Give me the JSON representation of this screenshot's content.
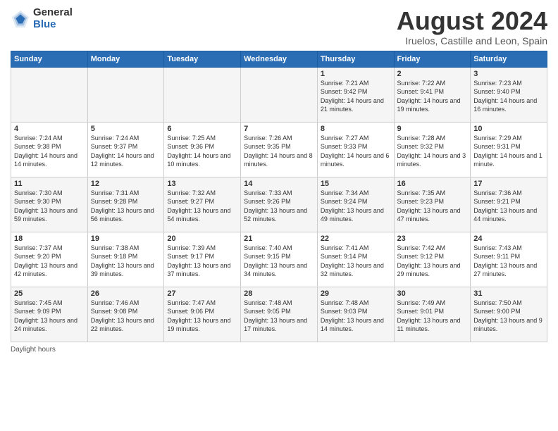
{
  "header": {
    "logo_general": "General",
    "logo_blue": "Blue",
    "title": "August 2024",
    "subtitle": "Iruelos, Castille and Leon, Spain"
  },
  "days_of_week": [
    "Sunday",
    "Monday",
    "Tuesday",
    "Wednesday",
    "Thursday",
    "Friday",
    "Saturday"
  ],
  "weeks": [
    [
      {
        "num": "",
        "info": ""
      },
      {
        "num": "",
        "info": ""
      },
      {
        "num": "",
        "info": ""
      },
      {
        "num": "",
        "info": ""
      },
      {
        "num": "1",
        "info": "Sunrise: 7:21 AM\nSunset: 9:42 PM\nDaylight: 14 hours and 21 minutes."
      },
      {
        "num": "2",
        "info": "Sunrise: 7:22 AM\nSunset: 9:41 PM\nDaylight: 14 hours and 19 minutes."
      },
      {
        "num": "3",
        "info": "Sunrise: 7:23 AM\nSunset: 9:40 PM\nDaylight: 14 hours and 16 minutes."
      }
    ],
    [
      {
        "num": "4",
        "info": "Sunrise: 7:24 AM\nSunset: 9:38 PM\nDaylight: 14 hours and 14 minutes."
      },
      {
        "num": "5",
        "info": "Sunrise: 7:24 AM\nSunset: 9:37 PM\nDaylight: 14 hours and 12 minutes."
      },
      {
        "num": "6",
        "info": "Sunrise: 7:25 AM\nSunset: 9:36 PM\nDaylight: 14 hours and 10 minutes."
      },
      {
        "num": "7",
        "info": "Sunrise: 7:26 AM\nSunset: 9:35 PM\nDaylight: 14 hours and 8 minutes."
      },
      {
        "num": "8",
        "info": "Sunrise: 7:27 AM\nSunset: 9:33 PM\nDaylight: 14 hours and 6 minutes."
      },
      {
        "num": "9",
        "info": "Sunrise: 7:28 AM\nSunset: 9:32 PM\nDaylight: 14 hours and 3 minutes."
      },
      {
        "num": "10",
        "info": "Sunrise: 7:29 AM\nSunset: 9:31 PM\nDaylight: 14 hours and 1 minute."
      }
    ],
    [
      {
        "num": "11",
        "info": "Sunrise: 7:30 AM\nSunset: 9:30 PM\nDaylight: 13 hours and 59 minutes."
      },
      {
        "num": "12",
        "info": "Sunrise: 7:31 AM\nSunset: 9:28 PM\nDaylight: 13 hours and 56 minutes."
      },
      {
        "num": "13",
        "info": "Sunrise: 7:32 AM\nSunset: 9:27 PM\nDaylight: 13 hours and 54 minutes."
      },
      {
        "num": "14",
        "info": "Sunrise: 7:33 AM\nSunset: 9:26 PM\nDaylight: 13 hours and 52 minutes."
      },
      {
        "num": "15",
        "info": "Sunrise: 7:34 AM\nSunset: 9:24 PM\nDaylight: 13 hours and 49 minutes."
      },
      {
        "num": "16",
        "info": "Sunrise: 7:35 AM\nSunset: 9:23 PM\nDaylight: 13 hours and 47 minutes."
      },
      {
        "num": "17",
        "info": "Sunrise: 7:36 AM\nSunset: 9:21 PM\nDaylight: 13 hours and 44 minutes."
      }
    ],
    [
      {
        "num": "18",
        "info": "Sunrise: 7:37 AM\nSunset: 9:20 PM\nDaylight: 13 hours and 42 minutes."
      },
      {
        "num": "19",
        "info": "Sunrise: 7:38 AM\nSunset: 9:18 PM\nDaylight: 13 hours and 39 minutes."
      },
      {
        "num": "20",
        "info": "Sunrise: 7:39 AM\nSunset: 9:17 PM\nDaylight: 13 hours and 37 minutes."
      },
      {
        "num": "21",
        "info": "Sunrise: 7:40 AM\nSunset: 9:15 PM\nDaylight: 13 hours and 34 minutes."
      },
      {
        "num": "22",
        "info": "Sunrise: 7:41 AM\nSunset: 9:14 PM\nDaylight: 13 hours and 32 minutes."
      },
      {
        "num": "23",
        "info": "Sunrise: 7:42 AM\nSunset: 9:12 PM\nDaylight: 13 hours and 29 minutes."
      },
      {
        "num": "24",
        "info": "Sunrise: 7:43 AM\nSunset: 9:11 PM\nDaylight: 13 hours and 27 minutes."
      }
    ],
    [
      {
        "num": "25",
        "info": "Sunrise: 7:45 AM\nSunset: 9:09 PM\nDaylight: 13 hours and 24 minutes."
      },
      {
        "num": "26",
        "info": "Sunrise: 7:46 AM\nSunset: 9:08 PM\nDaylight: 13 hours and 22 minutes."
      },
      {
        "num": "27",
        "info": "Sunrise: 7:47 AM\nSunset: 9:06 PM\nDaylight: 13 hours and 19 minutes."
      },
      {
        "num": "28",
        "info": "Sunrise: 7:48 AM\nSunset: 9:05 PM\nDaylight: 13 hours and 17 minutes."
      },
      {
        "num": "29",
        "info": "Sunrise: 7:48 AM\nSunset: 9:03 PM\nDaylight: 13 hours and 14 minutes."
      },
      {
        "num": "30",
        "info": "Sunrise: 7:49 AM\nSunset: 9:01 PM\nDaylight: 13 hours and 11 minutes."
      },
      {
        "num": "31",
        "info": "Sunrise: 7:50 AM\nSunset: 9:00 PM\nDaylight: 13 hours and 9 minutes."
      }
    ]
  ],
  "footer": {
    "daylight_label": "Daylight hours"
  }
}
